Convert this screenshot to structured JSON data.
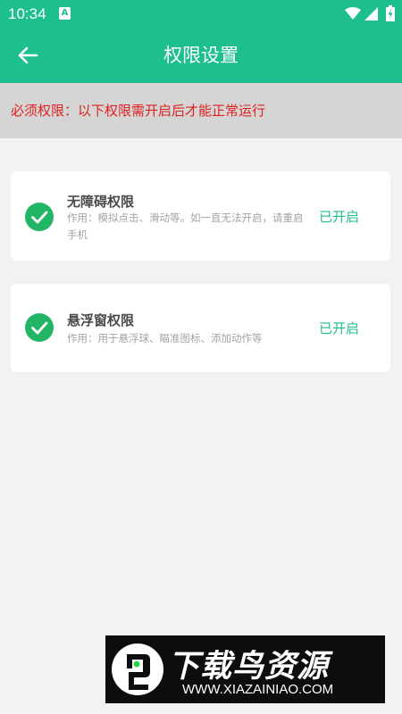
{
  "status_bar": {
    "time": "10:34",
    "notification_glyph": "A",
    "icons": [
      "wifi-icon",
      "signal-icon",
      "battery-charging-icon"
    ]
  },
  "app_bar": {
    "title": "权限设置",
    "back_icon": "arrow-left-icon",
    "color": "#1ebf8e"
  },
  "notice": {
    "text": "必须权限：以下权限需开启后才能正常运行",
    "color": "#e0201f"
  },
  "permissions": [
    {
      "title": "无障碍权限",
      "description": "作用：模拟点击、滑动等。如一直无法开启，请重启手机",
      "status": "已开启",
      "icon": "check-circle-icon"
    },
    {
      "title": "悬浮窗权限",
      "description": "作用：用于悬浮球、瞄准图标、添加动作等",
      "status": "已开启",
      "icon": "check-circle-icon"
    }
  ],
  "watermark": {
    "name": "下载鸟资源",
    "url": "WWW.XIAZAINIAO.COM"
  },
  "colors": {
    "accent": "#1ebf8e",
    "check_green": "#22b565",
    "warning_red": "#e0201f"
  }
}
